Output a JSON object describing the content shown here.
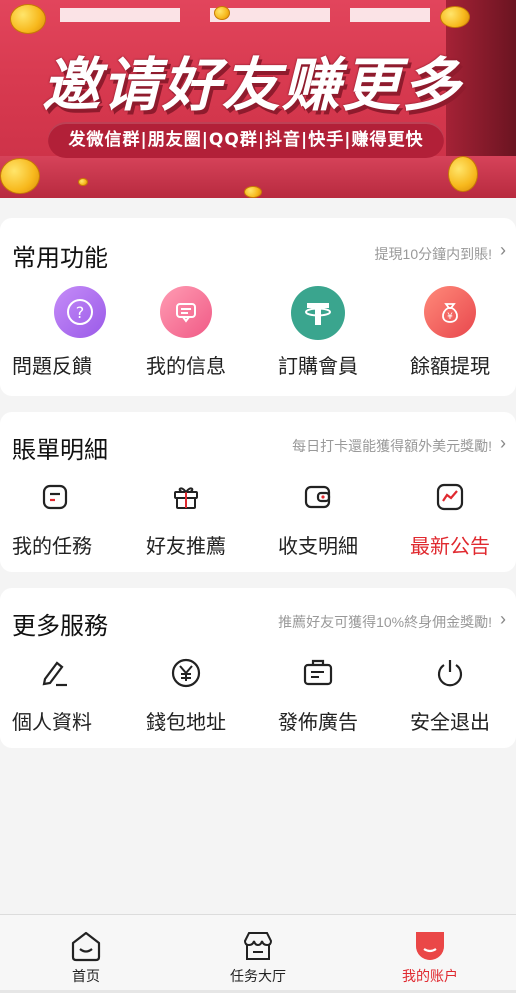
{
  "banner": {
    "title": "邀请好友赚更多",
    "subtitle": "发微信群|朋友圈|QQ群|抖音|快手|赚得更快"
  },
  "sections": [
    {
      "title": "常用功能",
      "hint": "提現10分鐘内到賬!",
      "items": [
        {
          "label": "問題反饋",
          "icon": "question-icon"
        },
        {
          "label": "我的信息",
          "icon": "message-icon"
        },
        {
          "label": "訂購會員",
          "icon": "tether-icon"
        },
        {
          "label": "餘額提現",
          "icon": "money-bag-icon"
        }
      ]
    },
    {
      "title": "賬單明細",
      "hint": "每日打卡還能獲得額外美元獎勵!",
      "items": [
        {
          "label": "我的任務",
          "icon": "task-icon"
        },
        {
          "label": "好友推薦",
          "icon": "gift-icon"
        },
        {
          "label": "收支明細",
          "icon": "wallet-icon"
        },
        {
          "label": "最新公告",
          "icon": "chart-icon"
        }
      ]
    },
    {
      "title": "更多服務",
      "hint": "推薦好友可獲得10%終身佣金獎勵!",
      "items": [
        {
          "label": "個人資料",
          "icon": "edit-icon"
        },
        {
          "label": "錢包地址",
          "icon": "yen-icon"
        },
        {
          "label": "發佈廣告",
          "icon": "briefcase-icon"
        },
        {
          "label": "安全退出",
          "icon": "power-icon"
        }
      ]
    }
  ],
  "tabbar": {
    "items": [
      {
        "label": "首页",
        "icon": "home-icon"
      },
      {
        "label": "任务大厅",
        "icon": "store-icon"
      },
      {
        "label": "我的账户",
        "icon": "account-icon"
      }
    ],
    "active": "我的账户"
  },
  "colors": {
    "accent": "#e0292f",
    "banner": "#d83a50"
  }
}
